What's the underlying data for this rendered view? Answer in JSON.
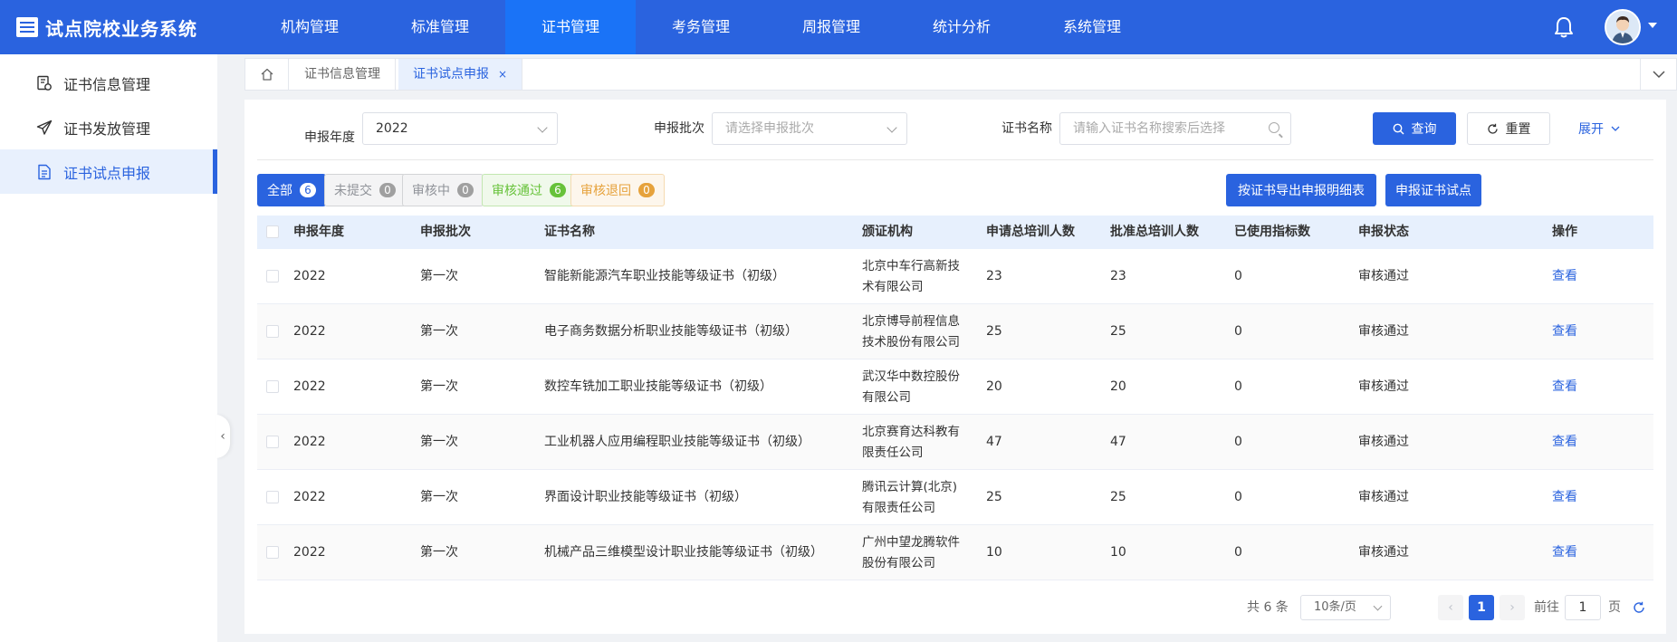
{
  "app": {
    "title": "试点院校业务系统"
  },
  "nav": {
    "items": [
      {
        "label": "机构管理"
      },
      {
        "label": "标准管理"
      },
      {
        "label": "证书管理"
      },
      {
        "label": "考务管理"
      },
      {
        "label": "周报管理"
      },
      {
        "label": "统计分析"
      },
      {
        "label": "系统管理"
      }
    ],
    "active_index": 2
  },
  "sidebar": {
    "items": [
      {
        "label": "证书信息管理",
        "icon": "certificate-settings-icon"
      },
      {
        "label": "证书发放管理",
        "icon": "paper-plane-icon"
      },
      {
        "label": "证书试点申报",
        "icon": "document-icon"
      }
    ],
    "active_index": 2
  },
  "tabs": {
    "items": [
      {
        "label": "证书信息管理"
      },
      {
        "label": "证书试点申报",
        "close": "×"
      }
    ],
    "active_index": 1
  },
  "filters": {
    "year": {
      "label": "申报年度",
      "value": "2022"
    },
    "batch": {
      "label": "申报批次",
      "placeholder": "请选择申报批次"
    },
    "cert": {
      "label": "证书名称",
      "placeholder": "请输入证书名称搜索后选择"
    },
    "search_label": "查询",
    "reset_label": "重置",
    "expand_label": "展开"
  },
  "status_tabs": [
    {
      "label": "全部",
      "count": "6"
    },
    {
      "label": "未提交",
      "count": "0"
    },
    {
      "label": "审核中",
      "count": "0"
    },
    {
      "label": "审核通过",
      "count": "6"
    },
    {
      "label": "审核退回",
      "count": "0"
    }
  ],
  "actions": {
    "export_label": "按证书导出申报明细表",
    "apply_label": "申报证书试点"
  },
  "table": {
    "columns": [
      "申报年度",
      "申报批次",
      "证书名称",
      "颁证机构",
      "申请总培训人数",
      "批准总培训人数",
      "已使用指标数",
      "申报状态",
      "操作"
    ],
    "rows": [
      {
        "year": "2022",
        "batch": "第一次",
        "name": "智能新能源汽车职业技能等级证书（初级）",
        "org": "北京中车行高新技术有限公司",
        "applied": "23",
        "approved": "23",
        "used": "0",
        "status": "审核通过",
        "op": "查看"
      },
      {
        "year": "2022",
        "batch": "第一次",
        "name": "电子商务数据分析职业技能等级证书（初级）",
        "org": "北京博导前程信息技术股份有限公司",
        "applied": "25",
        "approved": "25",
        "used": "0",
        "status": "审核通过",
        "op": "查看"
      },
      {
        "year": "2022",
        "batch": "第一次",
        "name": "数控车铣加工职业技能等级证书（初级）",
        "org": "武汉华中数控股份有限公司",
        "applied": "20",
        "approved": "20",
        "used": "0",
        "status": "审核通过",
        "op": "查看"
      },
      {
        "year": "2022",
        "batch": "第一次",
        "name": "工业机器人应用编程职业技能等级证书（初级）",
        "org": "北京赛育达科教有限责任公司",
        "applied": "47",
        "approved": "47",
        "used": "0",
        "status": "审核通过",
        "op": "查看"
      },
      {
        "year": "2022",
        "batch": "第一次",
        "name": "界面设计职业技能等级证书（初级）",
        "org": "腾讯云计算(北京)有限责任公司",
        "applied": "25",
        "approved": "25",
        "used": "0",
        "status": "审核通过",
        "op": "查看"
      },
      {
        "year": "2022",
        "batch": "第一次",
        "name": "机械产品三维模型设计职业技能等级证书（初级）",
        "org": "广州中望龙腾软件股份有限公司",
        "applied": "10",
        "approved": "10",
        "used": "0",
        "status": "审核通过",
        "op": "查看"
      }
    ]
  },
  "pagination": {
    "total_text": "共 6 条",
    "page_size": "10条/页",
    "prev": "‹",
    "current_page": "1",
    "next": "›",
    "goto_label": "前往",
    "goto_value": "1",
    "page_suffix": "页"
  },
  "colors": {
    "primary": "#2a63df",
    "header_bg": "#2a63df",
    "success": "#67c23a",
    "warning": "#e6a23c"
  }
}
